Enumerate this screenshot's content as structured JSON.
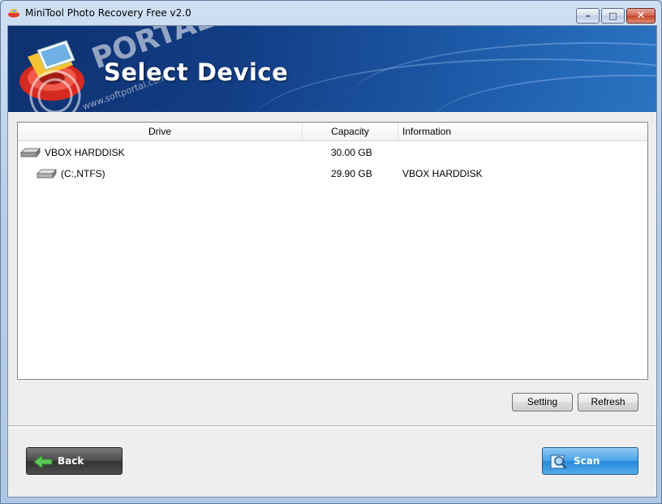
{
  "window": {
    "title": "MiniTool Photo Recovery Free v2.0",
    "controls": {
      "minimize": "–",
      "maximize": "□",
      "close": "✕"
    }
  },
  "banner": {
    "title": "Select Device",
    "watermark": "PORTAL",
    "watermark_sub": "www.softportal.com"
  },
  "device_list": {
    "columns": [
      "Drive",
      "Capacity",
      "Information"
    ],
    "rows": [
      {
        "drive": "VBOX HARDDISK",
        "capacity": "30.00 GB",
        "information": "",
        "level": 0
      },
      {
        "drive": "(C:,NTFS)",
        "capacity": "29.90 GB",
        "information": "VBOX HARDDISK",
        "level": 1
      }
    ]
  },
  "buttons": {
    "setting": "Setting",
    "refresh": "Refresh",
    "back": "Back",
    "scan": "Scan"
  },
  "colors": {
    "banner": "#123d84",
    "scan_button": "#2588da",
    "back_button": "#4a4a4a"
  }
}
